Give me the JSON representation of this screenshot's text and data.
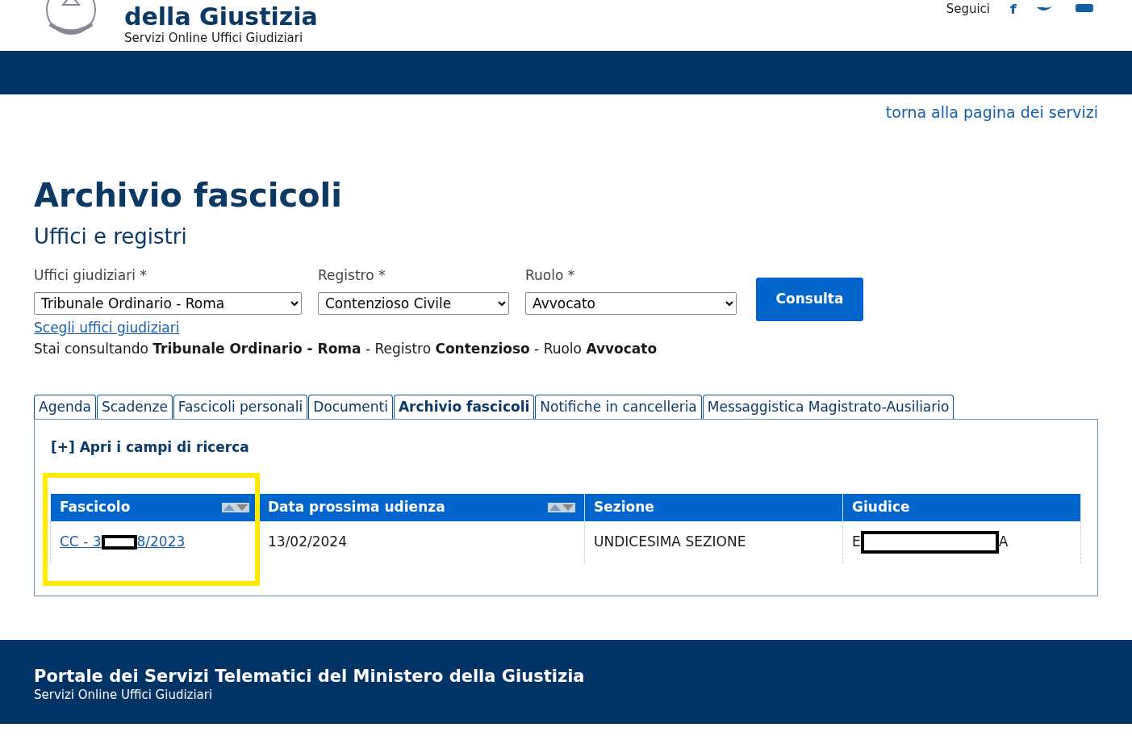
{
  "header": {
    "title": "della Giustizia",
    "subtitle": "Servizi Online Uffici Giudiziari",
    "follow_label": "Seguici"
  },
  "back_link": "torna alla pagina dei servizi",
  "page_title": "Archivio fascicoli",
  "section_title": "Uffici e registri",
  "filters": [
    {
      "label": "Uffici giudiziari *",
      "value": "Tribunale Ordinario - Roma"
    },
    {
      "label": "Registro *",
      "value": "Contenzioso Civile"
    },
    {
      "label": "Ruolo *",
      "value": "Avvocato"
    }
  ],
  "submit_button": "Consulta",
  "choose_link": "Scegli uffici giudiziari",
  "summary": "Stai consultando **Tribunale Ordinario - Roma** - Registro **Contenzioso** - Ruolo **Avvocato**",
  "tabs": [
    {
      "label": "Agenda",
      "selected": false
    },
    {
      "label": "Scadenze",
      "selected": false
    },
    {
      "label": "Fascicoli personali",
      "selected": false
    },
    {
      "label": "Documenti",
      "selected": false
    },
    {
      "label": "Archivio fascicoli",
      "selected": true
    },
    {
      "label": "Notifiche in cancelleria",
      "selected": false
    },
    {
      "label": "Messaggistica Magistrato-Ausiliario",
      "selected": false
    }
  ],
  "search_toggle": "[+] Apri i campi di ricerca",
  "table": {
    "columns": [
      {
        "label": "Fascicolo",
        "sortable": true
      },
      {
        "label": "Data prossima udienza",
        "sortable": true
      },
      {
        "label": "Sezione",
        "sortable": false
      },
      {
        "label": "Giudice",
        "sortable": false
      }
    ],
    "rows": [
      {
        "cells": [
          {
            "kind": "link",
            "parts": [
              "CC - 3",
              "8/2023"
            ]
          },
          {
            "kind": "text",
            "parts": [
              "13/02/2024"
            ]
          },
          {
            "kind": "text",
            "parts": [
              "UNDICESIMA SEZIONE"
            ]
          },
          {
            "kind": "text",
            "parts": [
              "E",
              "A"
            ]
          }
        ]
      }
    ]
  },
  "highlight_frame": true,
  "footer": {
    "title": "Portale dei Servizi Telematici del Ministero della Giustizia",
    "subtitle": "Servizi Online Uffici Giudiziari"
  }
}
